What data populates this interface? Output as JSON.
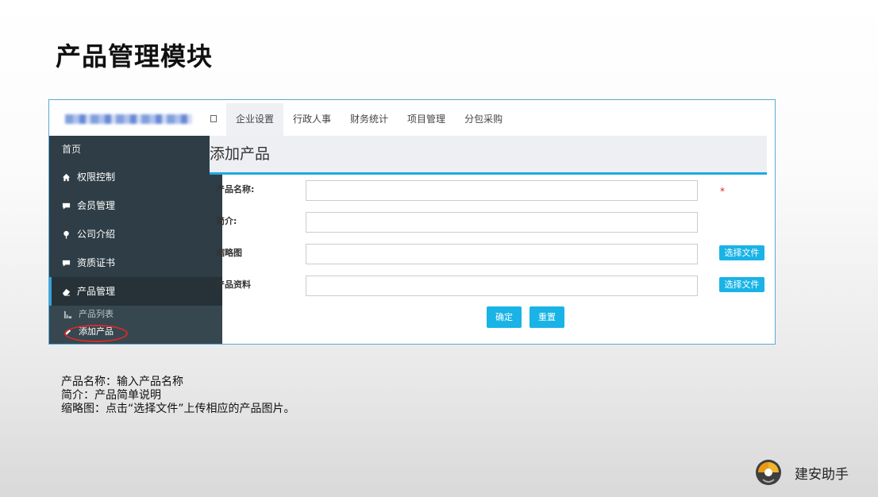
{
  "slide": {
    "title": "产品管理模块",
    "notes": [
      "产品名称：输入产品名称",
      "简介：产品简单说明",
      "缩略图：点击“选择文件”上传相应的产品图片。"
    ],
    "brand": "建安助手"
  },
  "app": {
    "tabs": [
      {
        "label": "企业设置",
        "active": true
      },
      {
        "label": "行政人事",
        "active": false
      },
      {
        "label": "财务统计",
        "active": false
      },
      {
        "label": "项目管理",
        "active": false
      },
      {
        "label": "分包采购",
        "active": false
      }
    ],
    "sidebar": {
      "home": "首页",
      "items": [
        {
          "label": "权限控制",
          "icon": "home-icon"
        },
        {
          "label": "会员管理",
          "icon": "comment-icon"
        },
        {
          "label": "公司介绍",
          "icon": "pin-icon"
        },
        {
          "label": "资质证书",
          "icon": "comment-icon"
        },
        {
          "label": "产品管理",
          "icon": "eraser-icon"
        }
      ],
      "sub_items": [
        {
          "label": "产品列表",
          "icon": "chart-icon"
        },
        {
          "label": "添加产品",
          "icon": "pen-icon"
        }
      ]
    },
    "panel": {
      "title": "添加产品",
      "fields": [
        {
          "label": "产品名称:",
          "value": "",
          "required_mark": "*"
        },
        {
          "label": "简介:",
          "value": ""
        },
        {
          "label": "缩略图",
          "value": "",
          "button": "选择文件"
        },
        {
          "label": "产品资料",
          "value": "",
          "button": "选择文件"
        }
      ],
      "confirm": "确定",
      "reset": "重置"
    },
    "colors": {
      "accent": "#19b3e6",
      "sidebar": "#2f3e46",
      "annotation": "#d42b2b"
    }
  }
}
